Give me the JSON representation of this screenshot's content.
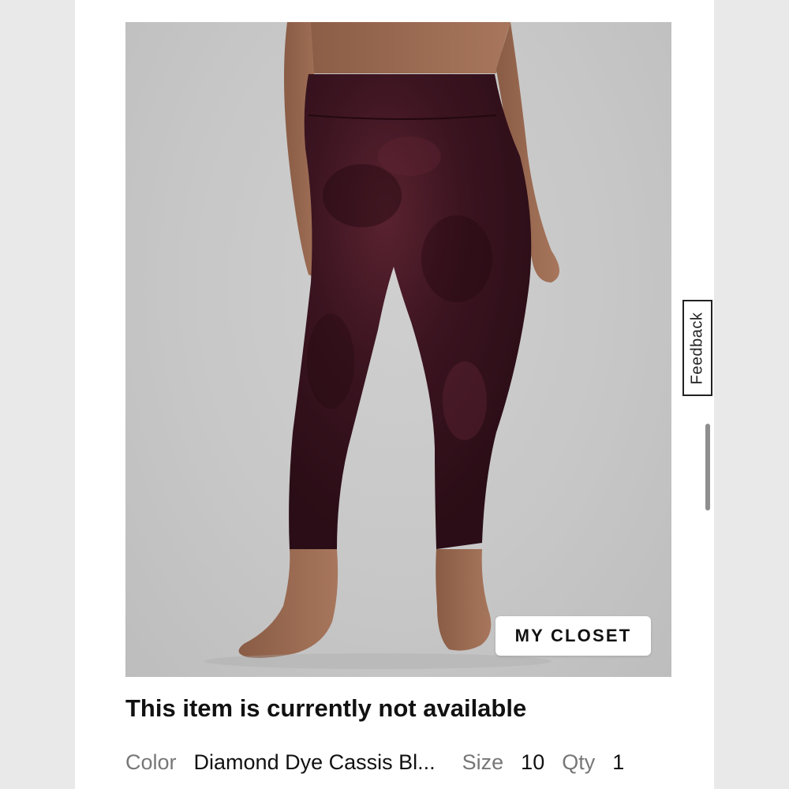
{
  "product": {
    "image_alt": "Person wearing high-rise cropped leggings",
    "closet_button": "MY CLOSET"
  },
  "status": {
    "message": "This item is currently not available"
  },
  "details": {
    "color_label": "Color",
    "color_value": "Diamond Dye Cassis Bl...",
    "size_label": "Size",
    "size_value": "10",
    "qty_label": "Qty",
    "qty_value": "1"
  },
  "feedback": {
    "label": "Feedback"
  },
  "colors": {
    "background_side": "#e9e9e9",
    "panel": "#ffffff",
    "leggings": "#3a1420",
    "skin": "#9a6a52",
    "text_primary": "#111111",
    "text_secondary": "#777777"
  }
}
